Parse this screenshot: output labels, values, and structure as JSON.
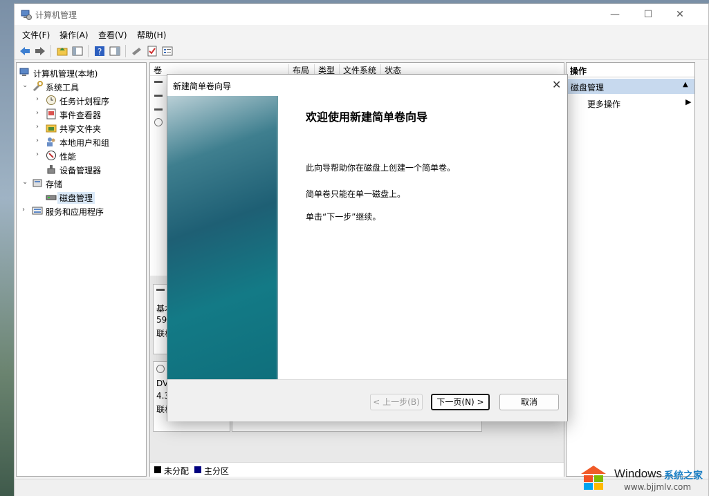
{
  "window": {
    "title": "计算机管理"
  },
  "caption_buttons": {
    "minimize": "—",
    "maximize": "☐",
    "close": "✕"
  },
  "menu": [
    "文件(F)",
    "操作(A)",
    "查看(V)",
    "帮助(H)"
  ],
  "tree": {
    "root": "计算机管理(本地)",
    "system_tools": "系统工具",
    "task_scheduler": "任务计划程序",
    "event_viewer": "事件查看器",
    "shared_folders": "共享文件夹",
    "local_users": "本地用户和组",
    "performance": "性能",
    "device_manager": "设备管理器",
    "storage": "存储",
    "disk_management": "磁盘管理",
    "services_apps": "服务和应用程序"
  },
  "columns": [
    "卷",
    "布局",
    "类型",
    "文件系统",
    "状态"
  ],
  "disks": [
    {
      "lines": [
        "基本",
        "59",
        "联机"
      ]
    },
    {
      "lines": [
        "DV",
        "4.3",
        "联机"
      ]
    }
  ],
  "legend": {
    "unallocated": "未分配",
    "primary": "主分区",
    "unallocated_color": "#000000",
    "primary_color": "#00007f"
  },
  "actions": {
    "header": "操作",
    "section": "磁盘管理",
    "more": "更多操作"
  },
  "dialog": {
    "title": "新建简单卷向导",
    "heading": "欢迎使用新建简单卷向导",
    "line1": "此向导帮助你在磁盘上创建一个简单卷。",
    "line2": "简单卷只能在单一磁盘上。",
    "line3": "单击“下一步”继续。",
    "back": "< 上一步(B)",
    "next": "下一页(N) >",
    "cancel": "取消"
  },
  "watermark": {
    "brand": "Windows",
    "site_cn": "系统之家",
    "url": "www.bjjmlv.com"
  }
}
